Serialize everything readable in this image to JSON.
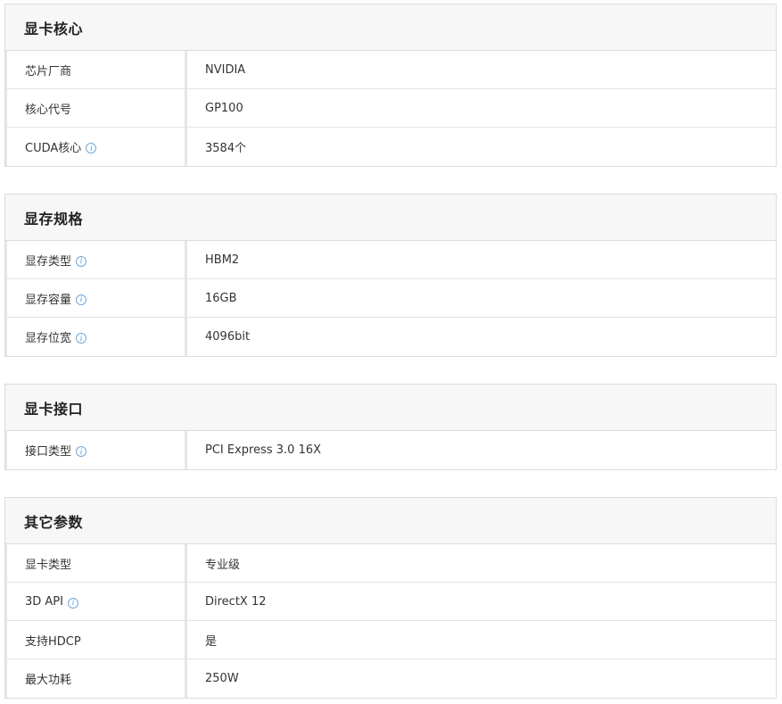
{
  "sections": [
    {
      "title": "显卡核心",
      "rows": [
        {
          "label": "芯片厂商",
          "value": "NVIDIA",
          "info": false
        },
        {
          "label": "核心代号",
          "value": "GP100",
          "info": false
        },
        {
          "label": "CUDA核心",
          "value": "3584个",
          "info": true
        }
      ]
    },
    {
      "title": "显存规格",
      "rows": [
        {
          "label": "显存类型",
          "value": "HBM2",
          "info": true
        },
        {
          "label": "显存容量",
          "value": "16GB",
          "info": true
        },
        {
          "label": "显存位宽",
          "value": "4096bit",
          "info": true
        }
      ]
    },
    {
      "title": "显卡接口",
      "rows": [
        {
          "label": "接口类型",
          "value": "PCI Express 3.0 16X",
          "info": true
        }
      ]
    },
    {
      "title": "其它参数",
      "rows": [
        {
          "label": "显卡类型",
          "value": "专业级",
          "info": false
        },
        {
          "label": "3D API",
          "value": "DirectX 12",
          "info": true
        },
        {
          "label": "支持HDCP",
          "value": "是",
          "info": false
        },
        {
          "label": "最大功耗",
          "value": "250W",
          "info": false
        }
      ]
    }
  ],
  "icons": {
    "info": "info-icon",
    "info_glyph": "i"
  },
  "colors": {
    "header_bg": "#f7f7f7",
    "border": "#dcdcdc",
    "info_icon": "#4a90d9"
  }
}
